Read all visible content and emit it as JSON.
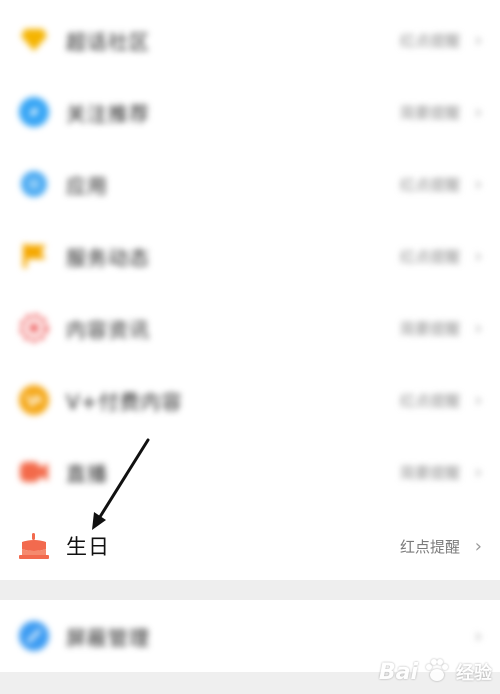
{
  "items": [
    {
      "label": "超话社区",
      "value": "红点提醒",
      "icon": "diamond-icon",
      "color": "#f5b400"
    },
    {
      "label": "关注推荐",
      "value": "简要提醒",
      "icon": "compass-icon",
      "color": "#38a6f5"
    },
    {
      "label": "应用",
      "value": "红点提醒",
      "icon": "app-icon",
      "color": "#4aaaf2"
    },
    {
      "label": "服务动态",
      "value": "红点提醒",
      "icon": "flag-icon",
      "color": "#f5a800"
    },
    {
      "label": "内容资讯",
      "value": "简要提醒",
      "icon": "gear-icon",
      "color": "#f06a6a"
    },
    {
      "label": "V+付费内容",
      "value": "红点提醒",
      "icon": "vplus-icon",
      "color": "#f5a818"
    },
    {
      "label": "直播",
      "value": "简要提醒",
      "icon": "video-icon",
      "color": "#f36a4a"
    }
  ],
  "birthday": {
    "label": "生日",
    "value": "红点提醒",
    "icon": "cake-icon",
    "color": "#f26a4e"
  },
  "blocked": {
    "label": "屏蔽管理",
    "icon": "block-icon",
    "color": "#3d9cf2"
  },
  "chevron": "›",
  "watermark": {
    "brand": "Bai",
    "suffix": "经验",
    "icon": "paw-icon"
  }
}
